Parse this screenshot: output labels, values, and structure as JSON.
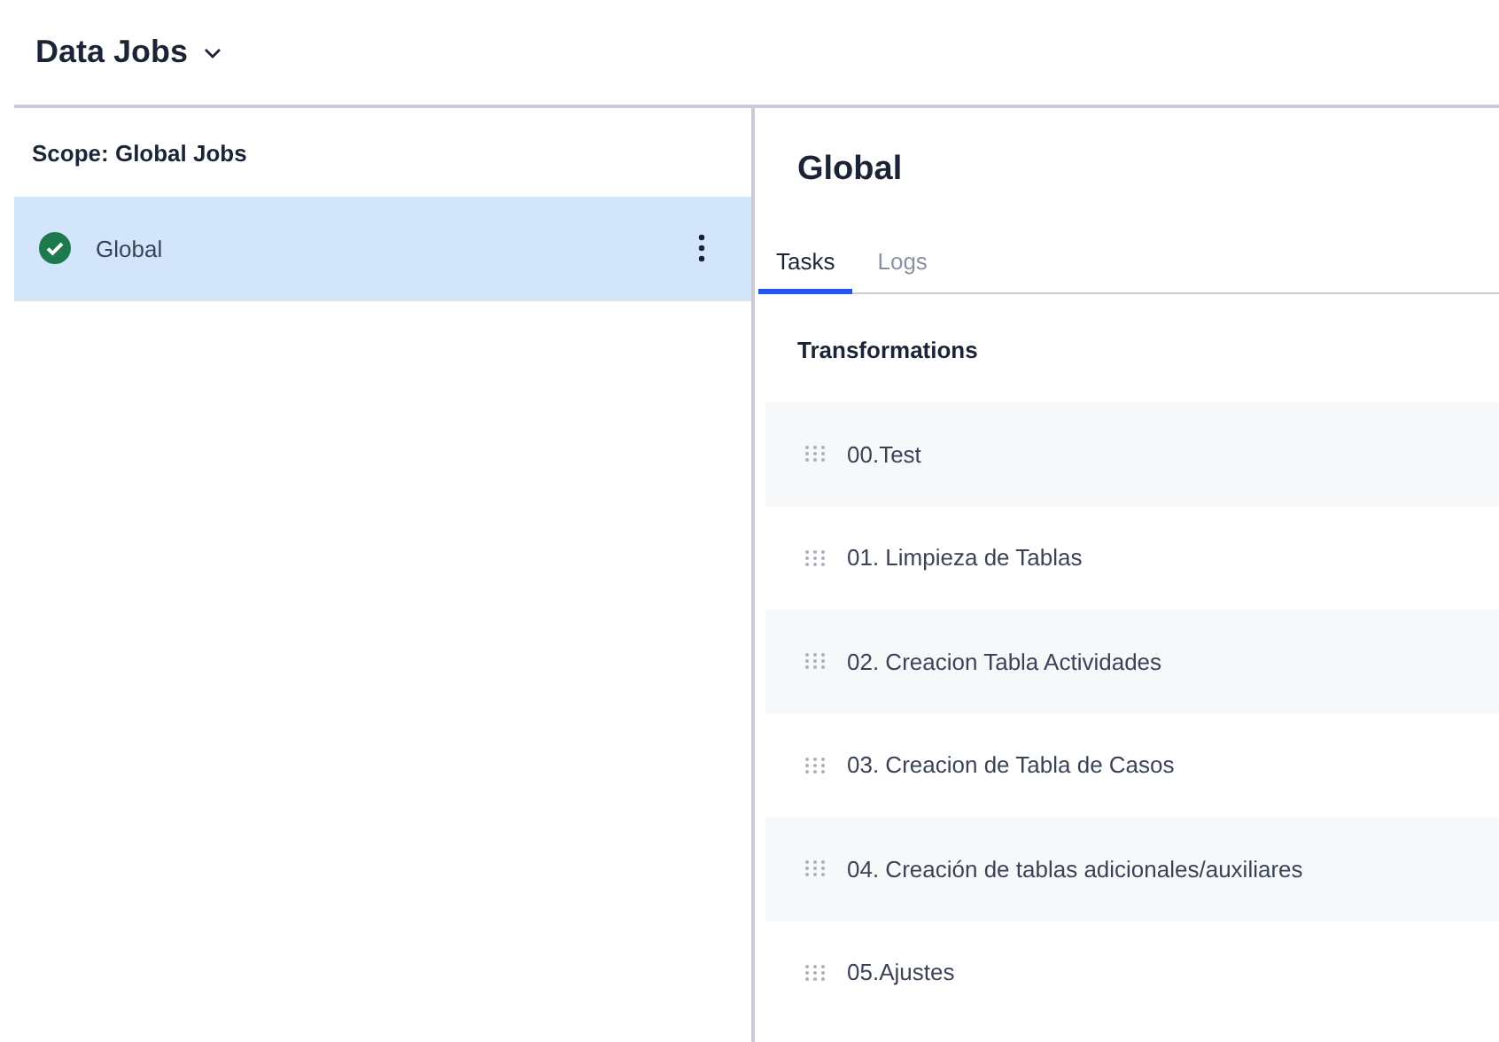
{
  "header": {
    "title": "Data Jobs"
  },
  "sidebar": {
    "scope_label": "Scope: Global Jobs",
    "items": [
      {
        "label": "Global",
        "selected": true,
        "succeeded": true
      }
    ]
  },
  "detail": {
    "title": "Global",
    "tabs": [
      {
        "label": "Tasks",
        "selected": true
      },
      {
        "label": "Logs",
        "selected": false
      }
    ],
    "section_title": "Transformations",
    "tasks": [
      {
        "label": "00.Test"
      },
      {
        "label": "01. Limpieza de Tablas"
      },
      {
        "label": "02. Creacion Tabla Actividades"
      },
      {
        "label": "03. Creacion de Tabla de Casos"
      },
      {
        "label": "04. Creación de tablas adicionales/auxiliares"
      },
      {
        "label": "05.Ajustes"
      }
    ]
  }
}
